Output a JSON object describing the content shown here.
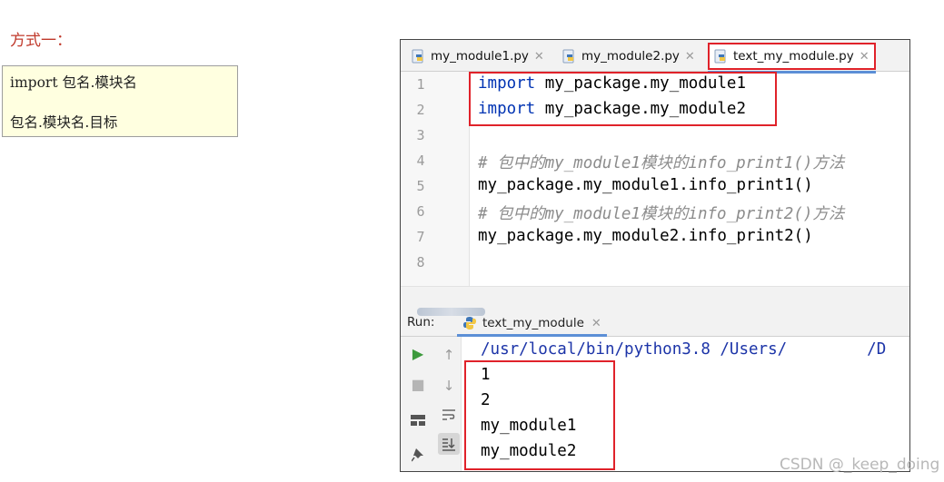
{
  "heading": "方式一：",
  "syntax": {
    "line1": "import 包名.模块名",
    "line2": "包名.模块名.目标"
  },
  "ide": {
    "tabs": [
      {
        "label": "my_module1.py",
        "active": false
      },
      {
        "label": "my_module2.py",
        "active": false
      },
      {
        "label": "text_my_module.py",
        "active": true
      }
    ],
    "line_numbers": [
      "1",
      "2",
      "3",
      "4",
      "5",
      "6",
      "7",
      "8"
    ],
    "code": {
      "line1_kw": "import",
      "line1_rest": " my_package.my_module1",
      "line2_kw": "import",
      "line2_rest": " my_package.my_module2",
      "line4_comment": "# 包中的my_module1模块的info_print1()方法",
      "line5": "my_package.my_module1.info_print1()",
      "line6_comment": "# 包中的my_module1模块的info_print2()方法",
      "line7": "my_package.my_module2.info_print2()"
    },
    "run_panel": {
      "label": "Run:",
      "tab_label": "text_my_module",
      "command_prefix": "/usr/local/bin/python3.8 /Users/",
      "command_suffix": "/D",
      "output": [
        "1",
        "2",
        "my_module1",
        "my_module2"
      ]
    },
    "colors": {
      "highlight_box": "#e0222a",
      "keyword": "#0033b3",
      "comment": "#8c8c8c",
      "run_green": "#3d9a3d"
    }
  },
  "watermark": "CSDN @_keep_doing"
}
